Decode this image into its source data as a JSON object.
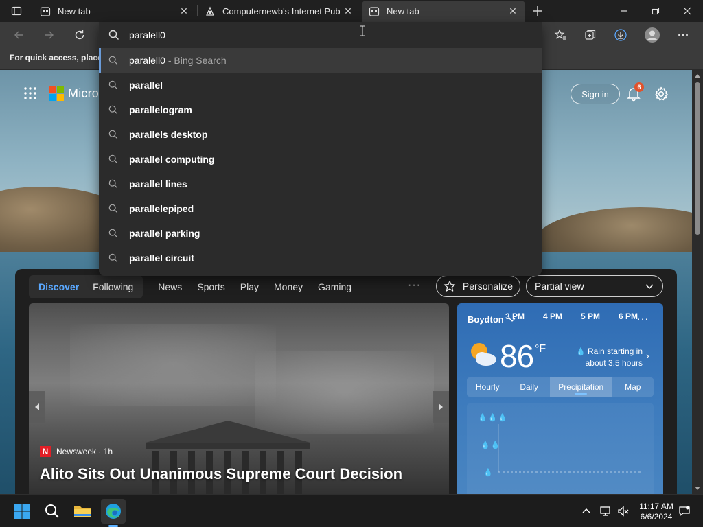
{
  "browser": {
    "tabs": [
      {
        "title": "New tab"
      },
      {
        "title": "Computernewb's Internet Pub H"
      },
      {
        "title": "New tab"
      }
    ],
    "favorites_hint": "For quick access, place y"
  },
  "omnibox": {
    "query": "paralell0",
    "first_suggestion": "paralell0",
    "first_suffix": " - Bing Search",
    "suggestions": [
      "parallel",
      "parallelogram",
      "parallels desktop",
      "parallel computing",
      "parallel lines",
      "parallelepiped",
      "parallel parking",
      "parallel circuit"
    ]
  },
  "newtab": {
    "brand": "Micros",
    "sign_in": "Sign in",
    "notifications": "6",
    "feed_tabs": {
      "discover": "Discover",
      "following": "Following",
      "nav": [
        "News",
        "Sports",
        "Play",
        "Money",
        "Gaming"
      ],
      "more": "···",
      "personalize": "Personalize",
      "view": "Partial view"
    }
  },
  "news": {
    "source": "Newsweek · 1h",
    "source_logo": "N",
    "headline": "Alito Sits Out Unanimous Supreme Court Decision"
  },
  "weather": {
    "location": "Boydton",
    "more": "···",
    "temp": "86",
    "unit": "°F",
    "rain_line1": "Rain starting in",
    "rain_line2": "about 3.5 hours",
    "tabs": [
      "Hourly",
      "Daily",
      "Precipitation",
      "Map"
    ],
    "hours": [
      "3 PM",
      "4 PM",
      "5 PM",
      "6 PM"
    ]
  },
  "taskbar": {
    "time": "11:17 AM",
    "date": "6/6/2024"
  },
  "colors": {
    "accent": "#5aa8ff",
    "notification_badge": "#e0532d",
    "weather_bg": "#3d7bbd"
  }
}
